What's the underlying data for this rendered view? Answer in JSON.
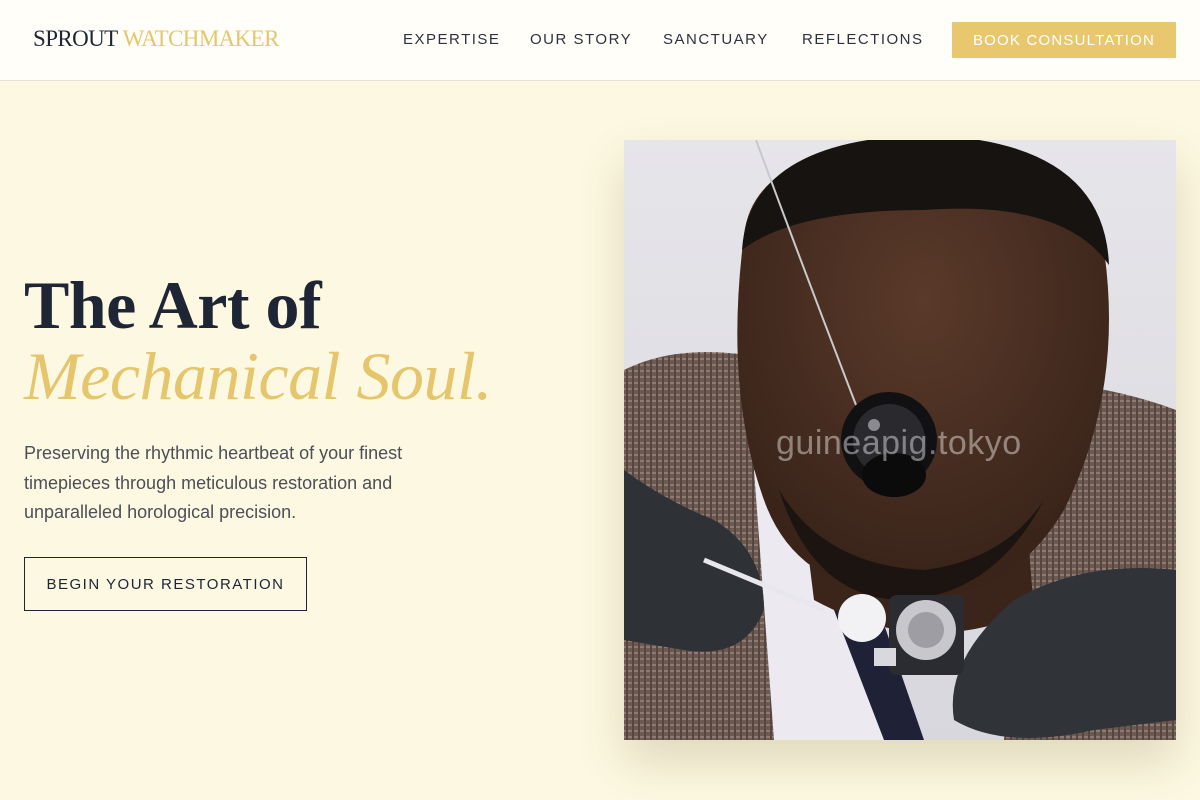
{
  "header": {
    "logo": {
      "part1": "SPROUT",
      "part2": "WATCHMAKER"
    },
    "nav": [
      "EXPERTISE",
      "OUR STORY",
      "SANCTUARY",
      "REFLECTIONS"
    ],
    "cta_label": "BOOK CONSULTATION"
  },
  "hero": {
    "title_line1": "The Art of",
    "title_line2": "Mechanical Soul.",
    "lede": "Preserving the rhythmic heartbeat of your finest timepieces through meticulous restoration and unparalleled horological precision.",
    "button_label": "BEGIN YOUR RESTORATION",
    "image_watermark": "guineapig.tokyo"
  },
  "colors": {
    "background": "#fdf8e1",
    "accent_gold": "#e8c76e",
    "text_dark": "#1e2535"
  }
}
